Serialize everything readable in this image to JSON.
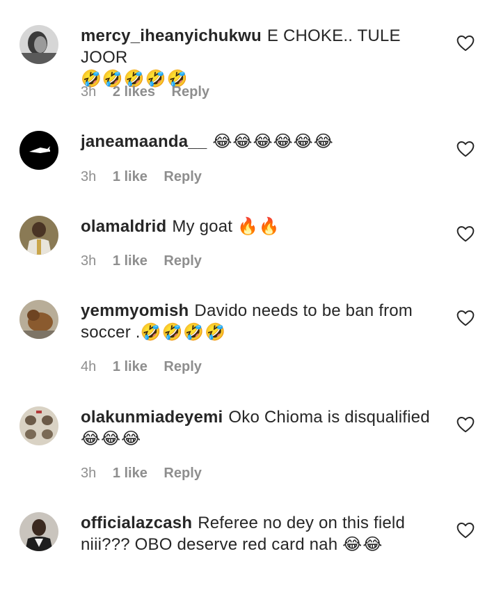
{
  "comments": [
    {
      "username": "mercy_iheanyichukwu",
      "text": "E CHOKE.. TULE JOOR",
      "emojis": "🤣🤣🤣🤣🤣",
      "time": "3h",
      "likes": "2 likes",
      "reply": "Reply"
    },
    {
      "username": "janeamaanda__",
      "text": "",
      "emojis": "😂😂😂😂😂😂",
      "time": "3h",
      "likes": "1 like",
      "reply": "Reply"
    },
    {
      "username": "olamaldrid",
      "text": "My goat",
      "emojis": "🔥🔥",
      "time": "3h",
      "likes": "1 like",
      "reply": "Reply"
    },
    {
      "username": "yemmyomish",
      "text": "Davido needs to be ban from soccer .",
      "emojis": "🤣🤣🤣🤣",
      "time": "4h",
      "likes": "1 like",
      "reply": "Reply"
    },
    {
      "username": "olakunmiadeyemi",
      "text": "Oko Chioma is disqualified",
      "emojis": "😂😂😂",
      "time": "3h",
      "likes": "1 like",
      "reply": "Reply"
    },
    {
      "username": "officialazcash",
      "text": "Referee no dey on this field niii??? OBO deserve red card nah",
      "emojis": "😂😂",
      "time": "",
      "likes": "",
      "reply": ""
    }
  ],
  "colors": {
    "text": "#262626",
    "meta": "#8e8e8e"
  },
  "icons": {
    "like": "heart-outline-icon"
  }
}
